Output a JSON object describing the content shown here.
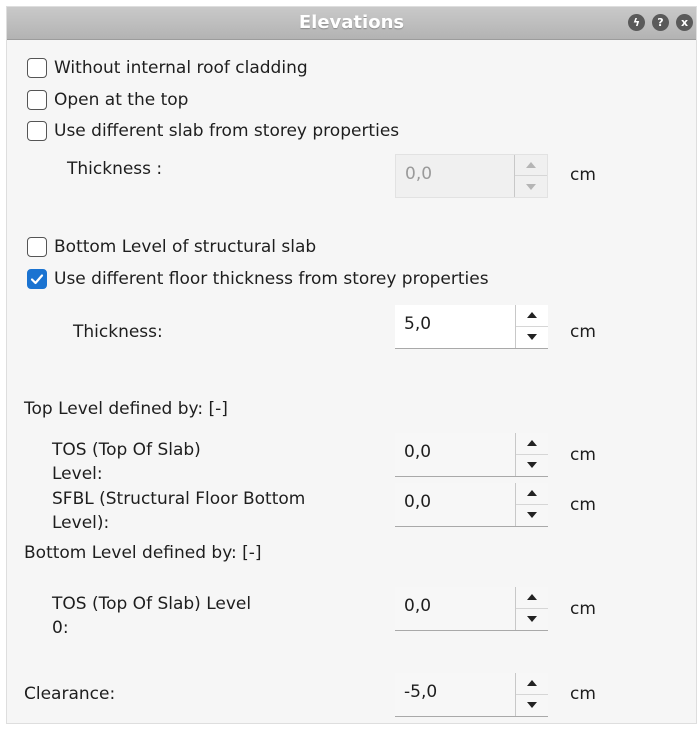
{
  "panel": {
    "title": "Elevations",
    "title_icons": [
      {
        "name": "lightning-icon",
        "glyph": "ϟ"
      },
      {
        "name": "help-icon",
        "glyph": "?"
      },
      {
        "name": "close-icon",
        "glyph": "x"
      }
    ]
  },
  "checkboxes": {
    "without_cladding": {
      "label": "Without internal roof cladding",
      "checked": false
    },
    "open_top": {
      "label": "Open at the top",
      "checked": false
    },
    "different_slab": {
      "label": "Use different slab from storey properties",
      "checked": false
    },
    "bottom_level": {
      "label": "Bottom Level of structural slab",
      "checked": false
    },
    "different_floor": {
      "label": "Use different floor thickness from storey properties",
      "checked": true
    }
  },
  "slab_thickness": {
    "label": "Thickness :",
    "value": "0,0",
    "unit": "cm",
    "disabled": true
  },
  "floor_thickness": {
    "label": "Thickness:",
    "value": "5,0",
    "unit": "cm"
  },
  "top_level": {
    "heading": "Top Level defined by: [-]",
    "tos": {
      "label_line1": "TOS (Top Of Slab)",
      "label_line2": "Level:",
      "value": "0,0",
      "unit": "cm"
    },
    "sfbl": {
      "label_line1": "SFBL (Structural Floor Bottom",
      "label_line2": "Level):",
      "value": "0,0",
      "unit": "cm"
    }
  },
  "bottom_level": {
    "heading": "Bottom Level defined by: [-]",
    "tos": {
      "label_line1": "TOS (Top Of Slab) Level",
      "label_line2": "0:",
      "value": "0,0",
      "unit": "cm"
    }
  },
  "clearance": {
    "label": "Clearance:",
    "value": "-5,0",
    "unit": "cm"
  },
  "colors": {
    "accent": "#1a73d1",
    "titlebar": "#b8b8b8",
    "panel_bg": "#f6f6f6"
  }
}
